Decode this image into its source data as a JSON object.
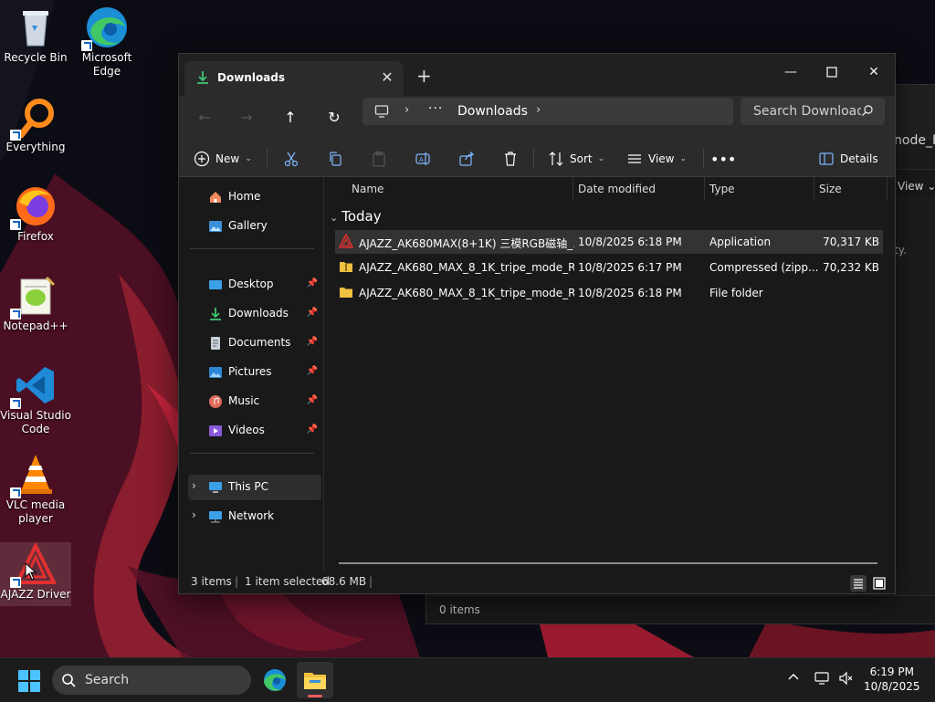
{
  "desktop": {
    "icons": [
      {
        "label": "Recycle Bin",
        "icon": "recycle-bin-icon"
      },
      {
        "label": "Microsoft Edge",
        "icon": "edge-icon"
      },
      {
        "label": "Everything",
        "icon": "everything-icon"
      },
      {
        "label": "Firefox",
        "icon": "firefox-icon"
      },
      {
        "label": "Notepad++",
        "icon": "notepad-plus-plus-icon"
      },
      {
        "label": "Visual Studio Code",
        "icon": "vscode-icon"
      },
      {
        "label": "VLC media player",
        "icon": "vlc-icon"
      },
      {
        "label": "AJAZZ Driver",
        "icon": "ajazz-driver-icon"
      }
    ]
  },
  "background_window": {
    "title_tail": "node_R",
    "view_label": "View",
    "empty_text_tail": "ty.",
    "status": "0 items"
  },
  "explorer": {
    "tab_title": "Downloads",
    "address": {
      "crumb": "Downloads",
      "more": "···"
    },
    "search_placeholder": "Search Downloads",
    "toolbar": {
      "new_label": "New",
      "sort_label": "Sort",
      "view_label": "View",
      "details_label": "Details"
    },
    "sidebar": {
      "home": "Home",
      "gallery": "Gallery",
      "desktop": "Desktop",
      "downloads": "Downloads",
      "documents": "Documents",
      "pictures": "Pictures",
      "music": "Music",
      "videos": "Videos",
      "this_pc": "This PC",
      "network": "Network"
    },
    "columns": {
      "name": "Name",
      "date": "Date modified",
      "type": "Type",
      "size": "Size"
    },
    "group": "Today",
    "files": [
      {
        "name": "AJAZZ_AK680MAX(8+1K) 三模RGB磁轴_...",
        "date": "10/8/2025 6:18 PM",
        "type": "Application",
        "size": "70,317 KB"
      },
      {
        "name": "AJAZZ_AK680_MAX_8_1K_tripe_mode_R...",
        "date": "10/8/2025 6:17 PM",
        "type": "Compressed (zipp...",
        "size": "70,232 KB"
      },
      {
        "name": "AJAZZ_AK680_MAX_8_1K_tripe_mode_R...",
        "date": "10/8/2025 6:18 PM",
        "type": "File folder",
        "size": ""
      }
    ],
    "status": {
      "items": "3 items",
      "selected": "1 item selected",
      "size": "68.6 MB"
    }
  },
  "taskbar": {
    "search_placeholder": "Search",
    "time": "6:19 PM",
    "date": "10/8/2025"
  },
  "colors": {
    "accent": "#4cc2ff",
    "ajazz_red": "#e03030",
    "folder": "#f0c040"
  }
}
